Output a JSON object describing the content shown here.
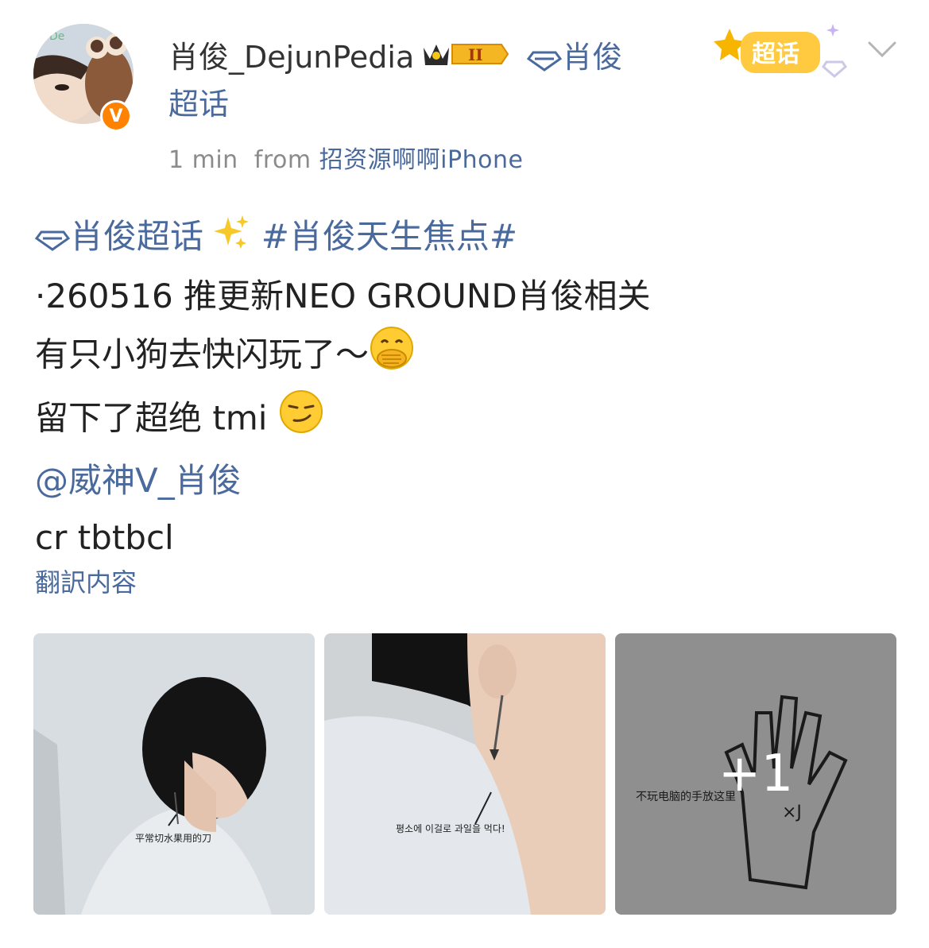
{
  "post": {
    "username": "肖俊_DejunPedia",
    "rank_badge": "II",
    "topic_link": "肖俊超话",
    "time": "1 min",
    "from_label": "from",
    "source": "招资源啊啊iPhone",
    "supertopic_label": "超话",
    "content": {
      "topic": "肖俊超话",
      "hashtag": "#肖俊天生焦点#",
      "line1": "·260516 推更新NEO GROUND肖俊相关",
      "line2": "有只小狗去快闪玩了～",
      "line3": "留下了超绝 tmi",
      "mention": "@威神V_肖俊",
      "credit": "cr tbtbcl"
    },
    "translate_label": "翻訳内容",
    "photos": {
      "photo1_caption": "平常切水果用的刀",
      "photo2_caption": "평소에 이걸로 과일을 먹다!",
      "photo3_caption": "不玩电脑的手放这里",
      "extra_count": "+1"
    },
    "icons": {
      "avatar": "avatar-image",
      "verify": "verified-v-icon",
      "crown": "crown-icon",
      "diamond": "supertopic-diamond-icon",
      "sparkles": "sparkles-emoji",
      "hand_over_mouth": "hand-over-mouth-emoji",
      "smirk": "smirk-emoji",
      "chevron": "chevron-down-icon"
    },
    "colors": {
      "link": "#4a6a9d",
      "meta": "#8b8b8b",
      "badge": "#ff8200"
    }
  }
}
